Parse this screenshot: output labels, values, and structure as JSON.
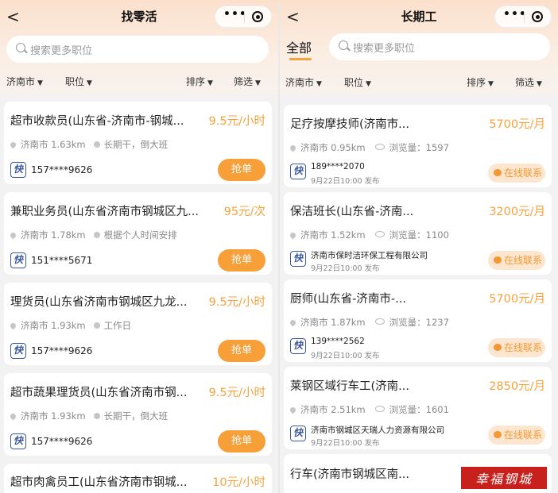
{
  "left": {
    "title": "找零活",
    "back_glyph": "<",
    "search_placeholder": "搜索更多职位",
    "filters": {
      "city": "济南市",
      "position": "职位",
      "sort": "排序",
      "filter": "筛选"
    },
    "jobs": [
      {
        "title": "超市收款员(山东省-济南市-钢城...",
        "pay": "9.5元/小时",
        "city": "济南市",
        "distance": "1.63km",
        "schedule": "长期干，倒大班",
        "logo": "快",
        "phone": "157****9626",
        "button": "抢单"
      },
      {
        "title": "兼职业务员(山东省济南市钢城区九...",
        "pay": "95元/次",
        "city": "济南市",
        "distance": "1.78km",
        "schedule": "根据个人时间安排",
        "logo": "快",
        "phone": "151****5671",
        "button": "抢单"
      },
      {
        "title": "理货员(山东省济南市钢城区九龙...",
        "pay": "9.5元/小时",
        "city": "济南市",
        "distance": "1.93km",
        "schedule": "工作日",
        "logo": "快",
        "phone": "157****9626",
        "button": "抢单"
      },
      {
        "title": "超市蔬果理货员(山东省济南市钢...",
        "pay": "9.5元/小时",
        "city": "济南市",
        "distance": "1.93km",
        "schedule": "长期干，倒大班",
        "logo": "快",
        "phone": "157****9626",
        "button": "抢单"
      },
      {
        "title": "超市肉禽员工(山东省济南市钢城...",
        "pay": "10元/小时"
      }
    ]
  },
  "right": {
    "title": "长期工",
    "back_glyph": "<",
    "tab_all": "全部",
    "search_placeholder": "搜索更多职位",
    "filters": {
      "city": "济南市",
      "position": "职位",
      "sort": "排序",
      "filter": "筛选"
    },
    "jobs": [
      {
        "title": "足疗按摩技师(济南市...",
        "pay": "5700元/月",
        "city": "济南市",
        "distance": "0.95km",
        "views_label": "浏览量：",
        "views": "1597",
        "logo": "快",
        "poster": "189****2070",
        "date": "9月22日10:00 发布",
        "button": "在线联系"
      },
      {
        "title": "保洁班长(山东省-济南...",
        "pay": "3200元/月",
        "city": "济南市",
        "distance": "1.52km",
        "views_label": "浏览量：",
        "views": "1100",
        "logo": "快",
        "poster": "济南市保时洁环保工程有限公司",
        "date": "9月22日10:00 发布",
        "button": "在线联系"
      },
      {
        "title": "厨师(山东省-济南市-...",
        "pay": "5700元/月",
        "city": "济南市",
        "distance": "1.87km",
        "views_label": "浏览量：",
        "views": "1237",
        "logo": "快",
        "poster": "139****2562",
        "date": "9月22日10:00 发布",
        "button": "在线联系"
      },
      {
        "title": "莱钢区域行车工(济南...",
        "pay": "2850元/月",
        "city": "济南市",
        "distance": "2.51km",
        "views_label": "浏览量：",
        "views": "1601",
        "logo": "快",
        "poster": "济南市钢城区天瑞人力资源有限公司",
        "date": "9月22日10:00 发布",
        "button": "在线联系"
      },
      {
        "title": "行车(济南市钢城区南..."
      }
    ]
  },
  "watermark": "幸福钢城"
}
